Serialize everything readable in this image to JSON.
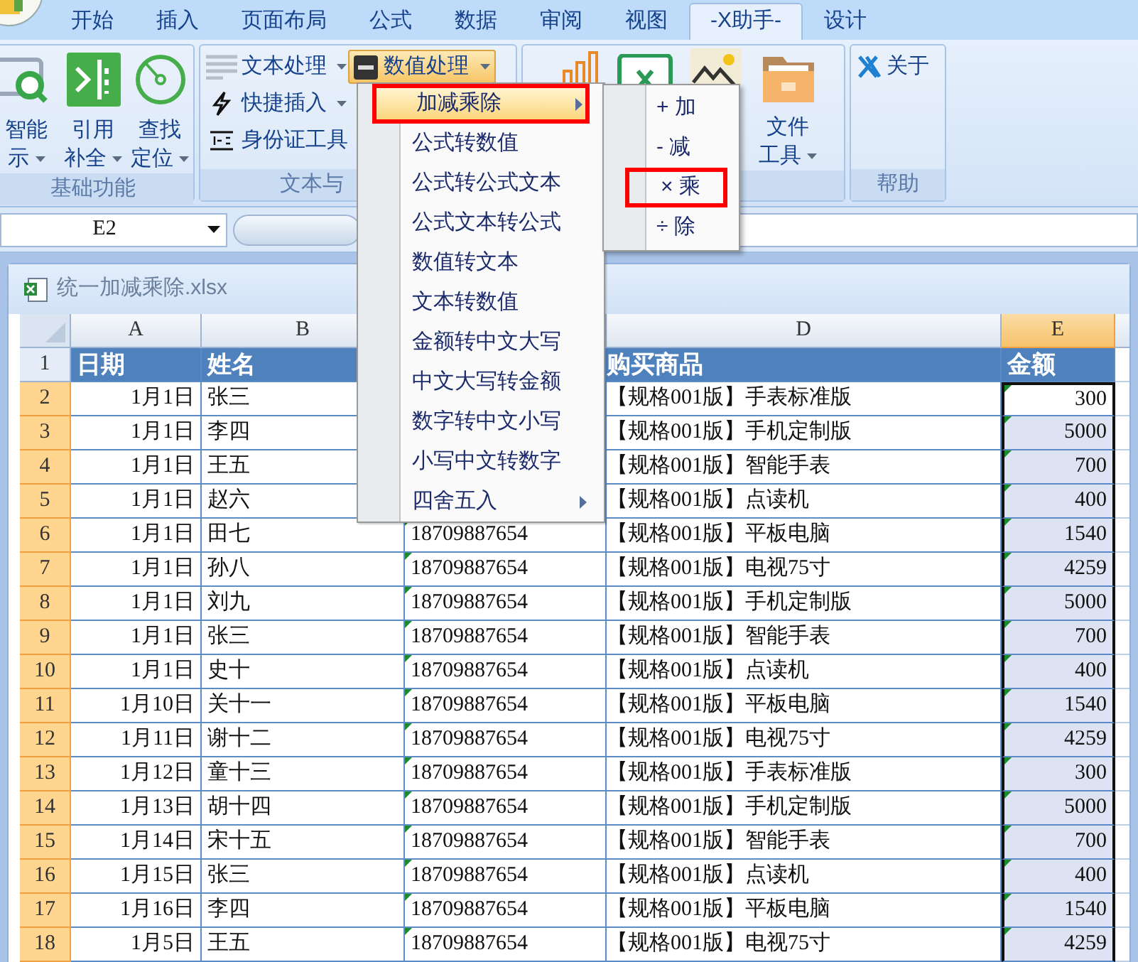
{
  "tabs": [
    {
      "label": "开始",
      "selected": false
    },
    {
      "label": "插入",
      "selected": false
    },
    {
      "label": "页面布局",
      "selected": false
    },
    {
      "label": "公式",
      "selected": false
    },
    {
      "label": "数据",
      "selected": false
    },
    {
      "label": "审阅",
      "selected": false
    },
    {
      "label": "视图",
      "selected": false
    },
    {
      "label": "-X助手-",
      "selected": true
    },
    {
      "label": "设计",
      "selected": false
    }
  ],
  "ribbon": {
    "basic_group": {
      "label": "基础功能",
      "buttons": [
        {
          "line1": "智能",
          "line2": "示",
          "dropdown": true
        },
        {
          "line1": "引用",
          "line2": "补全",
          "dropdown": true
        },
        {
          "line1": "查找",
          "line2": "定位",
          "dropdown": true
        }
      ]
    },
    "text_group": {
      "label": "文本与",
      "items": [
        {
          "label": "文本处理",
          "dropdown": true
        },
        {
          "label": "快捷插入",
          "dropdown": true
        },
        {
          "label": "身份证工具",
          "dropdown": false
        }
      ],
      "numeric_button": {
        "label": "数值处理",
        "dropdown": true,
        "open": true
      }
    },
    "tools_group": {
      "file_button": {
        "line1": "文件",
        "line2": "工具",
        "dropdown": true
      }
    },
    "help_group": {
      "label": "帮助",
      "about": "关于"
    }
  },
  "formula_bar": {
    "name_box": "E2"
  },
  "workbook": {
    "title": "统一加减乘除.xlsx",
    "columns": [
      {
        "label": "A",
        "selected": false
      },
      {
        "label": "B",
        "selected": false
      },
      {},
      {
        "label": "D",
        "selected": false
      },
      {
        "label": "E",
        "selected": true
      }
    ],
    "header": {
      "num": "1",
      "date": "日期",
      "name": "姓名",
      "product": "购买商品",
      "amount": "金额",
      "selected": false
    },
    "rows": [
      {
        "num": "2",
        "date": "1月1日",
        "name": "张三",
        "product": "【规格001版】手表标准版",
        "amount": "300",
        "selected": true,
        "active": true
      },
      {
        "num": "3",
        "date": "1月1日",
        "name": "李四",
        "product": "【规格001版】手机定制版",
        "amount": "5000",
        "selected": true,
        "active": false
      },
      {
        "num": "4",
        "date": "1月1日",
        "name": "王五",
        "product": "【规格001版】智能手表",
        "amount": "700",
        "selected": true,
        "active": false
      },
      {
        "num": "5",
        "date": "1月1日",
        "name": "赵六",
        "product": "【规格001版】点读机",
        "amount": "400",
        "selected": true,
        "active": false
      },
      {
        "num": "6",
        "date": "1月1日",
        "name": "田七",
        "phone": "18709887654",
        "product": "【规格001版】平板电脑",
        "amount": "1540",
        "selected": true,
        "active": false
      },
      {
        "num": "7",
        "date": "1月1日",
        "name": "孙八",
        "phone": "18709887654",
        "product": "【规格001版】电视75寸",
        "amount": "4259",
        "selected": true,
        "active": false
      },
      {
        "num": "8",
        "date": "1月1日",
        "name": "刘九",
        "phone": "18709887654",
        "product": "【规格001版】手机定制版",
        "amount": "5000",
        "selected": true,
        "active": false
      },
      {
        "num": "9",
        "date": "1月1日",
        "name": "张三",
        "phone": "18709887654",
        "product": "【规格001版】智能手表",
        "amount": "700",
        "selected": true,
        "active": false
      },
      {
        "num": "10",
        "date": "1月1日",
        "name": "史十",
        "phone": "18709887654",
        "product": "【规格001版】点读机",
        "amount": "400",
        "selected": true,
        "active": false
      },
      {
        "num": "11",
        "date": "1月10日",
        "name": "关十一",
        "phone": "18709887654",
        "product": "【规格001版】平板电脑",
        "amount": "1540",
        "selected": true,
        "active": false
      },
      {
        "num": "12",
        "date": "1月11日",
        "name": "谢十二",
        "phone": "18709887654",
        "product": "【规格001版】电视75寸",
        "amount": "4259",
        "selected": true,
        "active": false
      },
      {
        "num": "13",
        "date": "1月12日",
        "name": "童十三",
        "phone": "18709887654",
        "product": "【规格001版】手表标准版",
        "amount": "300",
        "selected": true,
        "active": false
      },
      {
        "num": "14",
        "date": "1月13日",
        "name": "胡十四",
        "phone": "18709887654",
        "product": "【规格001版】手机定制版",
        "amount": "5000",
        "selected": true,
        "active": false
      },
      {
        "num": "15",
        "date": "1月14日",
        "name": "宋十五",
        "phone": "18709887654",
        "product": "【规格001版】智能手表",
        "amount": "700",
        "selected": true,
        "active": false
      },
      {
        "num": "16",
        "date": "1月15日",
        "name": "张三",
        "phone": "18709887654",
        "product": "【规格001版】点读机",
        "amount": "400",
        "selected": true,
        "active": false
      },
      {
        "num": "17",
        "date": "1月16日",
        "name": "李四",
        "phone": "18709887654",
        "product": "【规格001版】平板电脑",
        "amount": "1540",
        "selected": true,
        "active": false
      },
      {
        "num": "18",
        "date": "1月5日",
        "name": "王五",
        "phone": "18709887654",
        "product": "【规格001版】电视75寸",
        "amount": "4259",
        "selected": true,
        "active": false
      }
    ]
  },
  "numeric_menu": {
    "items": [
      {
        "label": "加减乘除",
        "selected": true,
        "submenu": true,
        "highlighted": true
      },
      {
        "label": "公式转数值",
        "selected": false,
        "submenu": false,
        "highlighted": false
      },
      {
        "label": "公式转公式文本",
        "selected": false,
        "submenu": false,
        "highlighted": false
      },
      {
        "label": "公式文本转公式",
        "selected": false,
        "submenu": false,
        "highlighted": false
      },
      {
        "label": "数值转文本",
        "selected": false,
        "submenu": false,
        "highlighted": false
      },
      {
        "label": "文本转数值",
        "selected": false,
        "submenu": false,
        "highlighted": false
      },
      {
        "label": "金额转中文大写",
        "selected": false,
        "submenu": false,
        "highlighted": false
      },
      {
        "label": "中文大写转金额",
        "selected": false,
        "submenu": false,
        "highlighted": false
      },
      {
        "label": "数字转中文小写",
        "selected": false,
        "submenu": false,
        "highlighted": false
      },
      {
        "label": "小写中文转数字",
        "selected": false,
        "submenu": false,
        "highlighted": false
      },
      {
        "label": "四舍五入",
        "selected": false,
        "submenu": true,
        "highlighted": false
      }
    ]
  },
  "submenu": {
    "items": [
      {
        "label": "+ 加",
        "highlighted": false
      },
      {
        "label": "- 减",
        "highlighted": false
      },
      {
        "label": "× 乘",
        "highlighted": true
      },
      {
        "label": "÷ 除",
        "highlighted": false
      }
    ]
  }
}
